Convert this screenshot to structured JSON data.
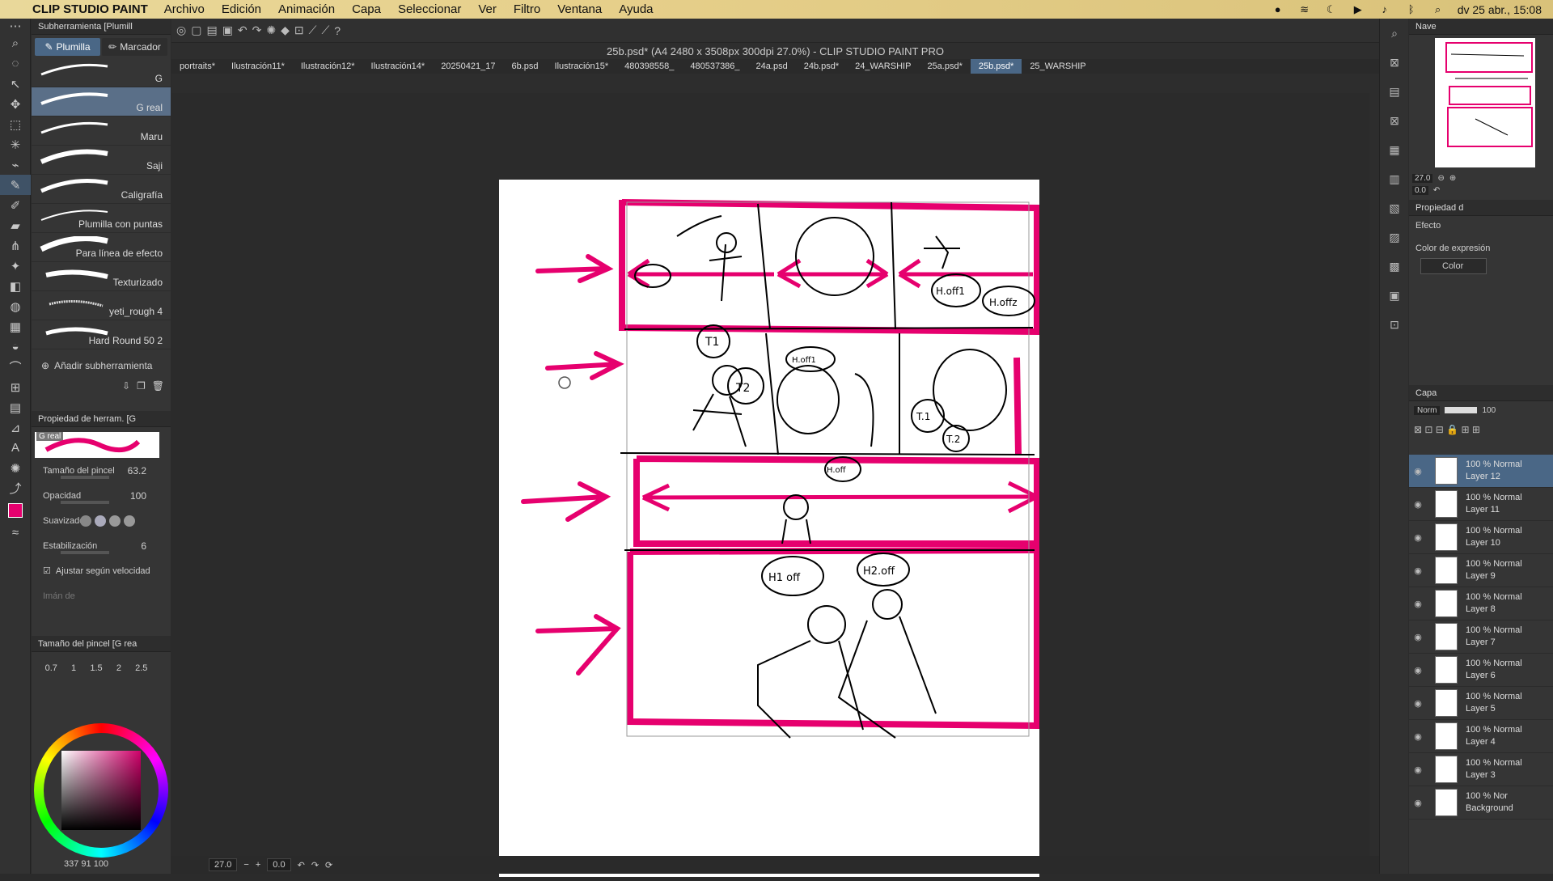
{
  "menubar": {
    "app": "CLIP STUDIO PAINT",
    "items": [
      "Archivo",
      "Edición",
      "Animación",
      "Capa",
      "Seleccionar",
      "Ver",
      "Filtro",
      "Ventana",
      "Ayuda"
    ],
    "datetime": "dv 25 abr., 15:08"
  },
  "title": "25b.psd* (A4 2480 x 3508px 300dpi 27.0%)  - CLIP STUDIO PAINT PRO",
  "tabs": [
    "portraits*",
    "Ilustración11*",
    "Ilustración12*",
    "Ilustración14*",
    "20250421_17",
    "6b.psd",
    "Ilustración15*",
    "480398558_",
    "480537386_",
    "24a.psd",
    "24b.psd*",
    "24_WARSHIP",
    "25a.psd*",
    "25b.psd*",
    "25_WARSHIP"
  ],
  "active_tab": "25b.psd*",
  "subtool": {
    "header": "Subherramienta [Plumill",
    "tabs": [
      "Plumilla",
      "Marcador"
    ],
    "brushes": [
      "G",
      "G real",
      "Maru",
      "Saji",
      "Caligrafía",
      "Plumilla con puntas",
      "Para línea de efecto",
      "Texturizado",
      "yeti_rough 4",
      "Hard Round 50 2"
    ],
    "selected": "G real",
    "add_label": "Añadir subherramienta"
  },
  "tool_property": {
    "header": "Propiedad de herram. [G",
    "preset": "G real",
    "brush_size_label": "Tamaño del pincel",
    "brush_size": "63.2",
    "opacity_label": "Opacidad",
    "opacity": "100",
    "smoothing_label": "Suavizado",
    "stabilization_label": "Estabilización",
    "stabilization": "6",
    "velocity_label": "Ajustar según velocidad",
    "magnet_label": "Imán de"
  },
  "brush_size_panel": {
    "header": "Tamaño del pincel [G rea",
    "sizes": [
      "0.7",
      "1",
      "1.5",
      "2",
      "2.5"
    ]
  },
  "color_readout": "337  91  100",
  "status": {
    "zoom": "27.0",
    "angle": "0.0"
  },
  "navigator": {
    "header": "Nave",
    "zoom": "27.0",
    "angle": "0.0"
  },
  "properties": {
    "header": "Propiedad d",
    "effect_label": "Efecto",
    "expression_label": "Color de expresión",
    "expression_value": "Color"
  },
  "layers": {
    "header": "Capa",
    "blend": "Norm",
    "opacity": "100",
    "items": [
      {
        "mode": "100 % Normal",
        "name": "Layer 12"
      },
      {
        "mode": "100 % Normal",
        "name": "Layer 11"
      },
      {
        "mode": "100 % Normal",
        "name": "Layer 10"
      },
      {
        "mode": "100 % Normal",
        "name": "Layer 9"
      },
      {
        "mode": "100 % Normal",
        "name": "Layer 8"
      },
      {
        "mode": "100 % Normal",
        "name": "Layer 7"
      },
      {
        "mode": "100 % Normal",
        "name": "Layer 6"
      },
      {
        "mode": "100 % Normal",
        "name": "Layer 5"
      },
      {
        "mode": "100 % Normal",
        "name": "Layer 4"
      },
      {
        "mode": "100 % Normal",
        "name": "Layer 3"
      },
      {
        "mode": "100 % Nor",
        "name": "Background"
      }
    ]
  },
  "canvas_labels": [
    "T1",
    "T2",
    "H.off1",
    "H.offz",
    "H.off1",
    "T.1",
    "T.2",
    "H1 off",
    "H2.off",
    "H.off"
  ],
  "colors": {
    "accent": "#e6006e",
    "selection": "#4a6786"
  }
}
